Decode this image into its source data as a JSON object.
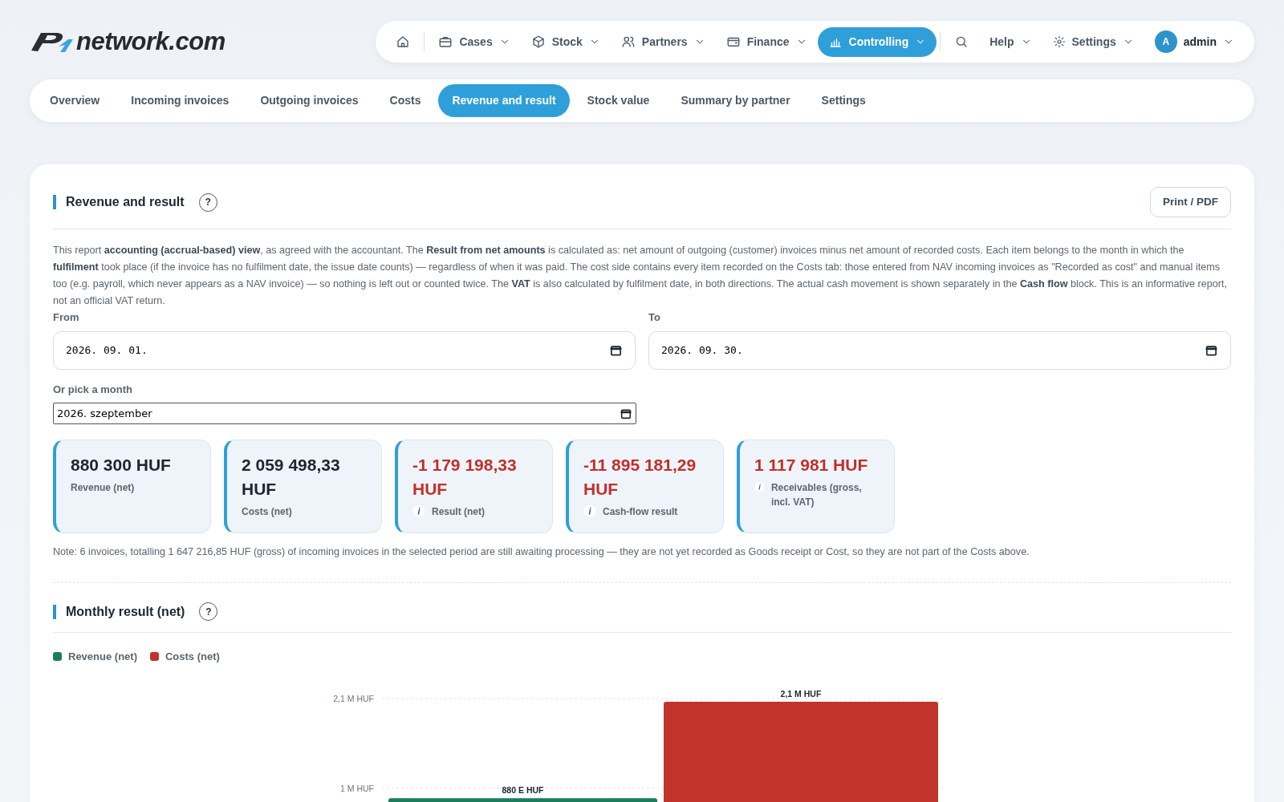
{
  "logo": {
    "text": "network.com"
  },
  "top_nav": [
    {
      "kind": "icon",
      "selected": false
    },
    {
      "kind": "menu",
      "label": "Cases",
      "selected": false
    },
    {
      "kind": "menu",
      "label": "Stock",
      "selected": false
    },
    {
      "kind": "menu",
      "label": "Partners",
      "selected": false
    },
    {
      "kind": "menu",
      "label": "Finance",
      "selected": false
    },
    {
      "kind": "menu",
      "label": "Controlling",
      "selected": true
    },
    {
      "kind": "icon",
      "selected": false
    },
    {
      "kind": "menu",
      "label": "Help",
      "selected": false
    },
    {
      "kind": "menu",
      "label": "Settings",
      "selected": false
    },
    {
      "kind": "user",
      "avatar": "A",
      "label": "admin",
      "selected": false
    }
  ],
  "tabs": [
    {
      "label": "Overview",
      "selected": false
    },
    {
      "label": "Incoming invoices",
      "selected": false
    },
    {
      "label": "Outgoing invoices",
      "selected": false
    },
    {
      "label": "Costs",
      "selected": false
    },
    {
      "label": "Revenue and result",
      "selected": true
    },
    {
      "label": "Stock value",
      "selected": false
    },
    {
      "label": "Summary by partner",
      "selected": false
    },
    {
      "label": "Settings",
      "selected": false
    }
  ],
  "report": {
    "title": "Revenue and result",
    "help": "?",
    "print_button": "Print / PDF",
    "description": "This report **accounting (accrual-based) view**, as agreed with the accountant. The **Result from net amounts** is calculated as: net amount of outgoing (customer) invoices minus net amount of recorded costs. Each item belongs to the month in which the **fulfilment** took place (if the invoice has no fulfilment date, the issue date counts) — regardless of when it was paid. The cost side contains every item recorded on the Costs tab: those entered from NAV incoming invoices as \"Recorded as cost\" and manual items too (e.g. payroll, which never appears as a NAV invoice) — so nothing is left out or counted twice. The **VAT** is also calculated by fulfilment date, in both directions. The actual cash movement is shown separately in the **Cash flow** block. This is an informative report, not an official VAT return.",
    "from": {
      "label": "From",
      "value": "2026. 09. 01."
    },
    "to": {
      "label": "To",
      "value": "2026. 09. 30."
    },
    "month": {
      "label": "Or pick a month",
      "value": "2026. szeptember"
    },
    "stats": [
      {
        "value": "880 300 HUF",
        "label": "Revenue (net)",
        "color": "#1b2631",
        "info": false
      },
      {
        "value": "2 059 498,33 HUF",
        "label": "Costs (net)",
        "color": "#1b2631",
        "info": false
      },
      {
        "value": "-1 179 198,33 HUF",
        "label": "Result (net)",
        "color": "#c0312b",
        "info": true
      },
      {
        "value": "-11 895 181,29 HUF",
        "label": "Cash-flow result",
        "color": "#c0312b",
        "info": true
      },
      {
        "value": "1 117 981 HUF",
        "label": "Receivables (gross, incl. VAT)",
        "color": "#c0312b",
        "info": true
      }
    ],
    "note": "Note: 6 invoices, totalling 1 647 216,85 HUF (gross) of incoming invoices in the selected period are still awaiting processing — they are not yet recorded as Goods receipt or Cost, so they are not part of the Costs above."
  },
  "monthly": {
    "title": "Monthly result (net)",
    "help": "?",
    "chart_data": {
      "type": "bar",
      "stacked": false,
      "ylim": [
        0,
        2100000
      ],
      "series": [
        {
          "name": "Revenue (net)",
          "color": "#1c7d5c",
          "values": [
            880000
          ]
        },
        {
          "name": "Costs (net)",
          "color": "#c0342b",
          "values": [
            2060000
          ]
        }
      ],
      "yticks": [
        {
          "value": 1000000,
          "label": "1 M HUF"
        },
        {
          "value": 2100000,
          "label": "2,1 M HUF"
        }
      ],
      "value_labels": [
        "880 E HUF",
        "2,1 M HUF"
      ]
    }
  }
}
